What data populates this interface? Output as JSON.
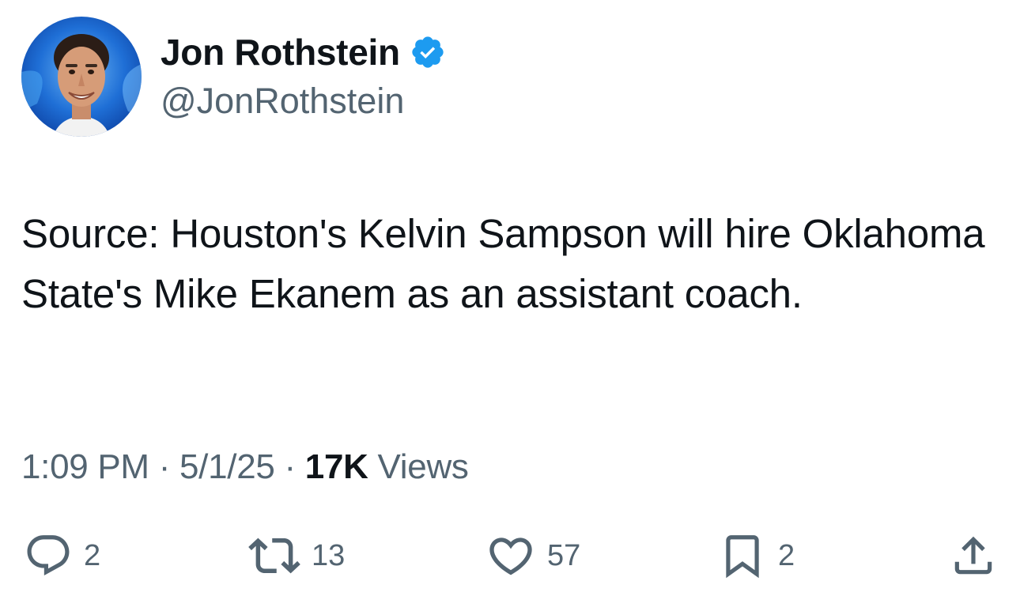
{
  "author": {
    "display_name": "Jon Rothstein",
    "handle": "@JonRothstein",
    "verified": true,
    "verified_color": "#1d9bf0"
  },
  "tweet": {
    "text": "Source: Houston's Kelvin Sampson will hire Oklahoma State's Mike Ekanem as an assistant coach."
  },
  "meta": {
    "time": "1:09 PM",
    "separator": "·",
    "date": "5/1/25",
    "views_count": "17K",
    "views_label": "Views"
  },
  "actions": {
    "replies": {
      "icon": "reply-icon",
      "count": "2"
    },
    "reposts": {
      "icon": "repost-icon",
      "count": "13"
    },
    "likes": {
      "icon": "heart-icon",
      "count": "57"
    },
    "bookmarks": {
      "icon": "bookmark-icon",
      "count": "2"
    },
    "share": {
      "icon": "share-icon"
    }
  },
  "colors": {
    "text_primary": "#0f1419",
    "text_secondary": "#536471",
    "accent": "#1d9bf0"
  }
}
